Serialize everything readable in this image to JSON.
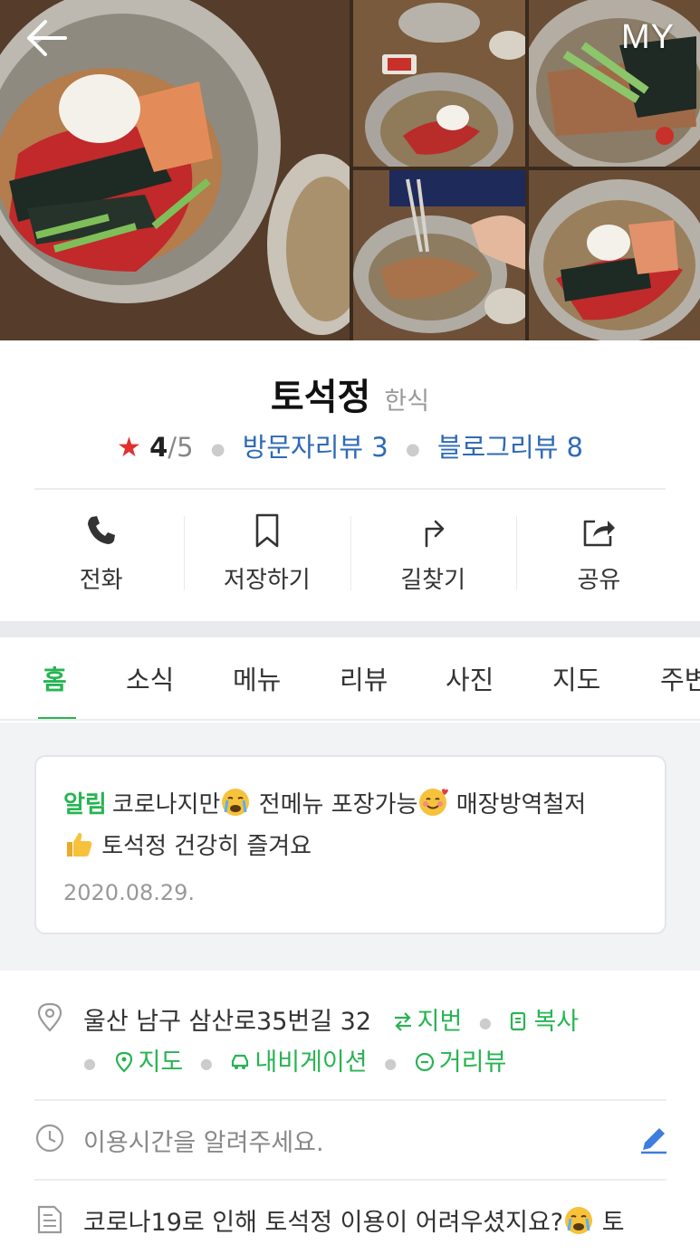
{
  "header": {
    "back_icon": "arrow-left-icon",
    "my_label": "MY"
  },
  "place": {
    "name": "토석정",
    "category": "한식",
    "rating_star": "★",
    "rating_score": "4",
    "rating_max": "/5",
    "visitor_reviews": "방문자리뷰 3",
    "blog_reviews": "블로그리뷰 8"
  },
  "actions": [
    {
      "label": "전화",
      "icon": "phone-icon"
    },
    {
      "label": "저장하기",
      "icon": "bookmark-icon"
    },
    {
      "label": "길찾기",
      "icon": "directions-icon"
    },
    {
      "label": "공유",
      "icon": "share-icon"
    }
  ],
  "tabs": [
    "홈",
    "소식",
    "메뉴",
    "리뷰",
    "사진",
    "지도",
    "주변"
  ],
  "active_tab": "홈",
  "notice": {
    "label": "알림",
    "text_1": "코로나지만",
    "text_2": " 전메뉴 포장가능",
    "text_3": " 매장방역철저",
    "text_4": " 토석정 건강히 즐겨요",
    "date": "2020.08.29."
  },
  "address": {
    "text": "울산 남구 삼산로35번길 32",
    "lot_number": "지번",
    "copy": "복사",
    "map": "지도",
    "navigation": "내비게이션",
    "street_view": "거리뷰"
  },
  "hours": {
    "placeholder": "이용시간을 알려주세요."
  },
  "description": {
    "text_1": "코로나19로 인해 토석정 이용이 어려우셨지요?",
    "text_2": " 토"
  },
  "colors": {
    "accent_green": "#28b452",
    "link_blue": "#2e6ab6",
    "star_red": "#e0312e",
    "edit_blue": "#3b7de0"
  }
}
